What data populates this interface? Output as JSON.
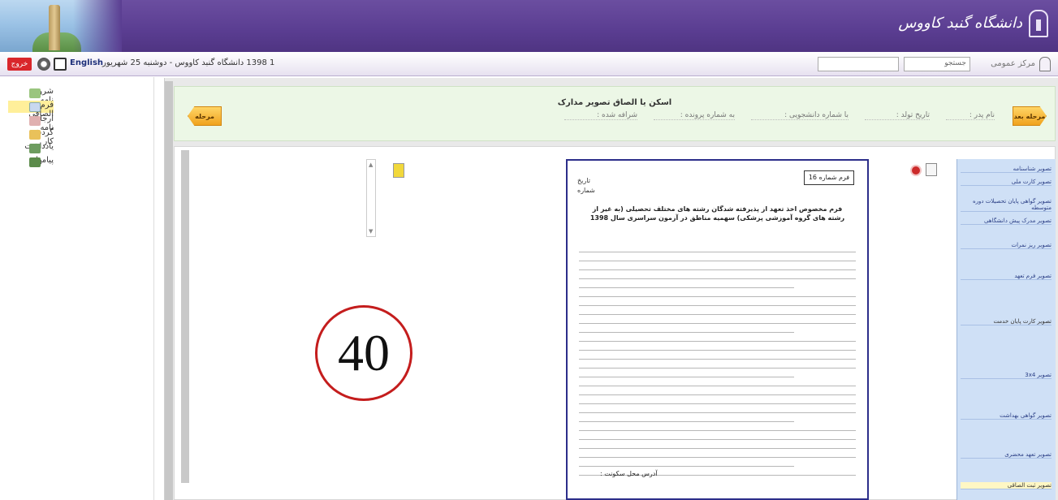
{
  "banner": {
    "university_name": "دانشگاه گنبد کاووس"
  },
  "toolbar": {
    "exit_label": "خروج",
    "english_label": "English",
    "status_text": "1 1398 دانشگاه گنبد کاووس - دوشنبه 25 شهریور",
    "center_label": "مرکز عمومی",
    "field1_placeholder": "جستجو"
  },
  "sidebar": {
    "items": [
      {
        "label": "شروع نامه"
      },
      {
        "label": "فرم الصاقی"
      },
      {
        "label": "ارجاع نامه"
      },
      {
        "label": "گردش کار"
      },
      {
        "label": "یادداشت"
      },
      {
        "label": "پیامها"
      }
    ]
  },
  "header_panel": {
    "title": "اسکن یا الصاق تصویر مدارک",
    "fields": [
      "نام پدر :",
      "تاریخ تولد :",
      "با شماره دانشجویی :",
      "به شماره پرونده :",
      "شرافه شده :"
    ],
    "prev_label": "مرحله قبل",
    "next_label": "مرحله بعد"
  },
  "circle_badge": {
    "number": "40"
  },
  "document": {
    "form_no": "فرم شماره 16",
    "date_label": "تاریخ",
    "number_label": "شماره",
    "headline": "فرم مخصوص اخذ تعهد از پذیرفته شدگان رشته های مختلف تحصیلی (به غیر از رشته های گروه آموزشی پزشکی) سهمیه مناطق در آزمون سراسری سال 1398",
    "footer_label": "آدرس محل سکونت :"
  },
  "right_list": {
    "items": [
      "تصویر شناسنامه",
      "تصویر کارت ملی",
      "تصویر گواهی پایان تحصیلات دوره متوسطه",
      "تصویر مدرک پیش دانشگاهی",
      "تصویر ریز نمرات",
      "تصویر فرم تعهد",
      "تصویر کارت پایان خدمت",
      "تصویر 3x4",
      "تصویر گواهی بهداشت",
      "تصویر تعهد محضری",
      "تصویر ثبت الصاقی"
    ]
  }
}
